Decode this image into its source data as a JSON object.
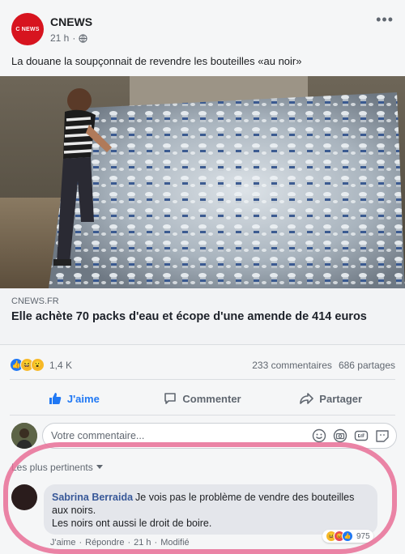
{
  "post": {
    "page_name": "CNEWS",
    "logo_text": "C NEWS",
    "time": "21 h",
    "separator": "·",
    "text": "La douane la soupçonnait de revendre les bouteilles «au noir»"
  },
  "link": {
    "domain": "CNEWS.FR",
    "title": "Elle achète 70 packs d'eau et écope d'une amende de 414 euros"
  },
  "stats": {
    "reactions_count": "1,4 K",
    "comments": "233 commentaires",
    "shares": "686 partages"
  },
  "actions": {
    "like": "J'aime",
    "comment": "Commenter",
    "share": "Partager"
  },
  "composer": {
    "placeholder": "Votre commentaire..."
  },
  "sort": {
    "label": "Les plus pertinents"
  },
  "comment": {
    "author": "Sabrina Berraida",
    "line1": "Je vois pas le problème de vendre des bouteilles aux noirs.",
    "line2": "Les noirs ont aussi le droit de boire.",
    "reactions_count": "975",
    "like": "J'aime",
    "reply": "Répondre",
    "time": "21 h",
    "edited": "Modifié",
    "dot": "·"
  },
  "colors": {
    "brand_red": "#d7141f",
    "like_blue": "#2078f4",
    "author_blue": "#385898",
    "marker_pink": "#e86e96"
  }
}
